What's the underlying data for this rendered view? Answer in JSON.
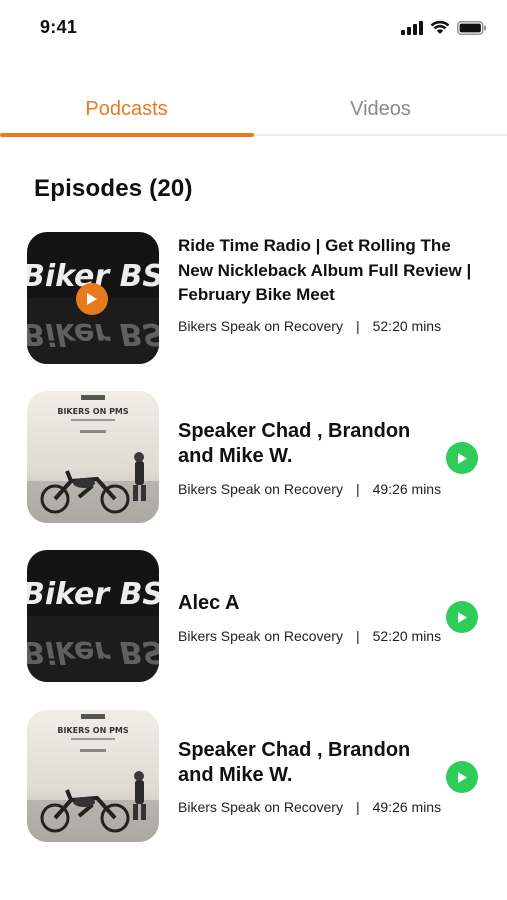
{
  "status_bar": {
    "time": "9:41",
    "icons": [
      "signal-icon",
      "wifi-icon",
      "battery-icon"
    ]
  },
  "tabs": [
    {
      "label": "Podcasts",
      "active": true
    },
    {
      "label": "Videos",
      "active": false
    }
  ],
  "colors": {
    "accent": "#e87a1e",
    "play_green": "#2ecc59",
    "inactive_tab": "#8a8a8a"
  },
  "episodes_header": "Episodes (20)",
  "episodes": [
    {
      "title_lines": [
        "Ride Time Radio | Get Rolling The",
        "New Nickleback Album Full Review |",
        "February Bike Meet"
      ],
      "show": "Bikers Speak on Recovery",
      "separator": "|",
      "duration": "52:20 mins",
      "artwork": "biker-bs-artwork",
      "thumb_text": "Biker BS",
      "playing": true
    },
    {
      "title_lines": [
        "Speaker Chad , Brandon",
        "and Mike W."
      ],
      "show": "Bikers Speak on Recovery",
      "separator": "|",
      "duration": "49:26 mins",
      "artwork": "bikers-on-pms-artwork",
      "thumb_text": "BIKERS ON PMS",
      "playing": false
    },
    {
      "title_lines": [
        "Alec A"
      ],
      "show": "Bikers Speak on Recovery",
      "separator": "|",
      "duration": "52:20 mins",
      "artwork": "biker-bs-artwork",
      "thumb_text": "Biker BS",
      "playing": false
    },
    {
      "title_lines": [
        "Speaker Chad , Brandon",
        "and Mike W."
      ],
      "show": "Bikers Speak on Recovery",
      "separator": "|",
      "duration": "49:26 mins",
      "artwork": "bikers-on-pms-artwork",
      "thumb_text": "BIKERS ON PMS",
      "playing": false
    }
  ]
}
